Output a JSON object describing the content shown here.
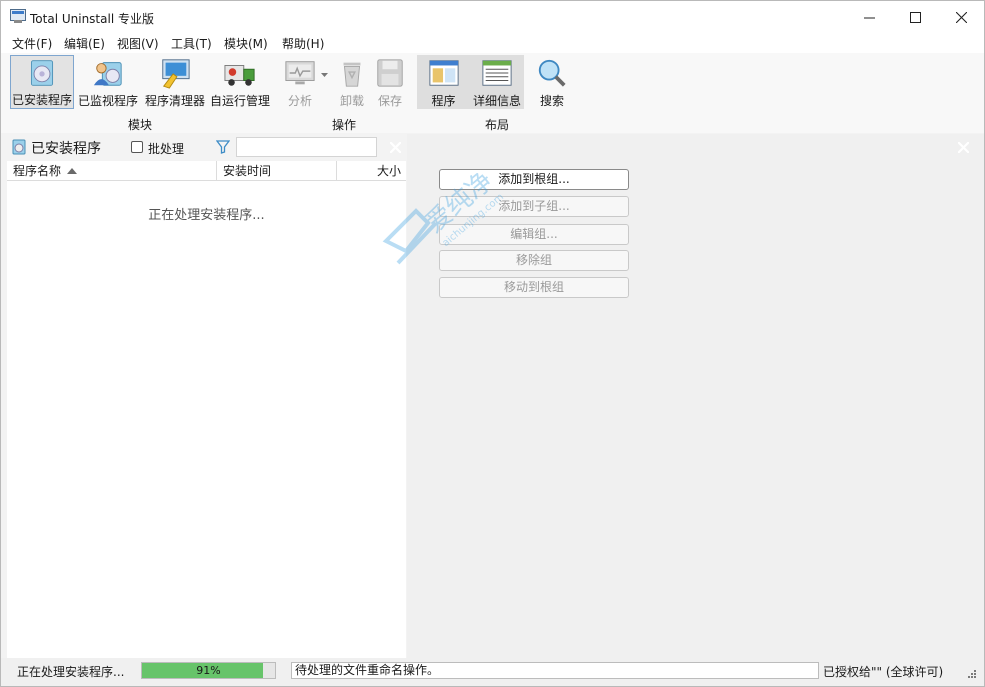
{
  "window": {
    "title": "Total Uninstall 专业版"
  },
  "menu": [
    "文件(F)",
    "编辑(E)",
    "视图(V)",
    "工具(T)",
    "模块(M)",
    "帮助(H)"
  ],
  "toolbar": {
    "modules": [
      "已安装程序",
      "已监视程序",
      "程序清理器",
      "自运行管理"
    ],
    "modules_group": "模块",
    "operations": [
      "分析",
      "卸载",
      "保存"
    ],
    "operations_group": "操作",
    "layout": [
      "程序",
      "详细信息"
    ],
    "search": "搜索",
    "layout_group": "布局"
  },
  "left": {
    "title": "已安装程序",
    "batch_label": "批处理",
    "filter_placeholder": "",
    "columns": [
      "程序名称",
      "安装时间",
      "大小"
    ],
    "processing": "正在处理安装程序..."
  },
  "right": {
    "buttons": [
      "添加到根组...",
      "添加到子组...",
      "编辑组...",
      "移除组",
      "移动到根组"
    ]
  },
  "status": {
    "left": "正在处理安装程序...",
    "progress_text": "91%",
    "progress_value": 0.91,
    "message": "待处理的文件重命名操作。",
    "license": "已授权给\"\" (全球许可)"
  },
  "watermark": {
    "text": "爱纯净",
    "sub": "aichunjing.com"
  }
}
